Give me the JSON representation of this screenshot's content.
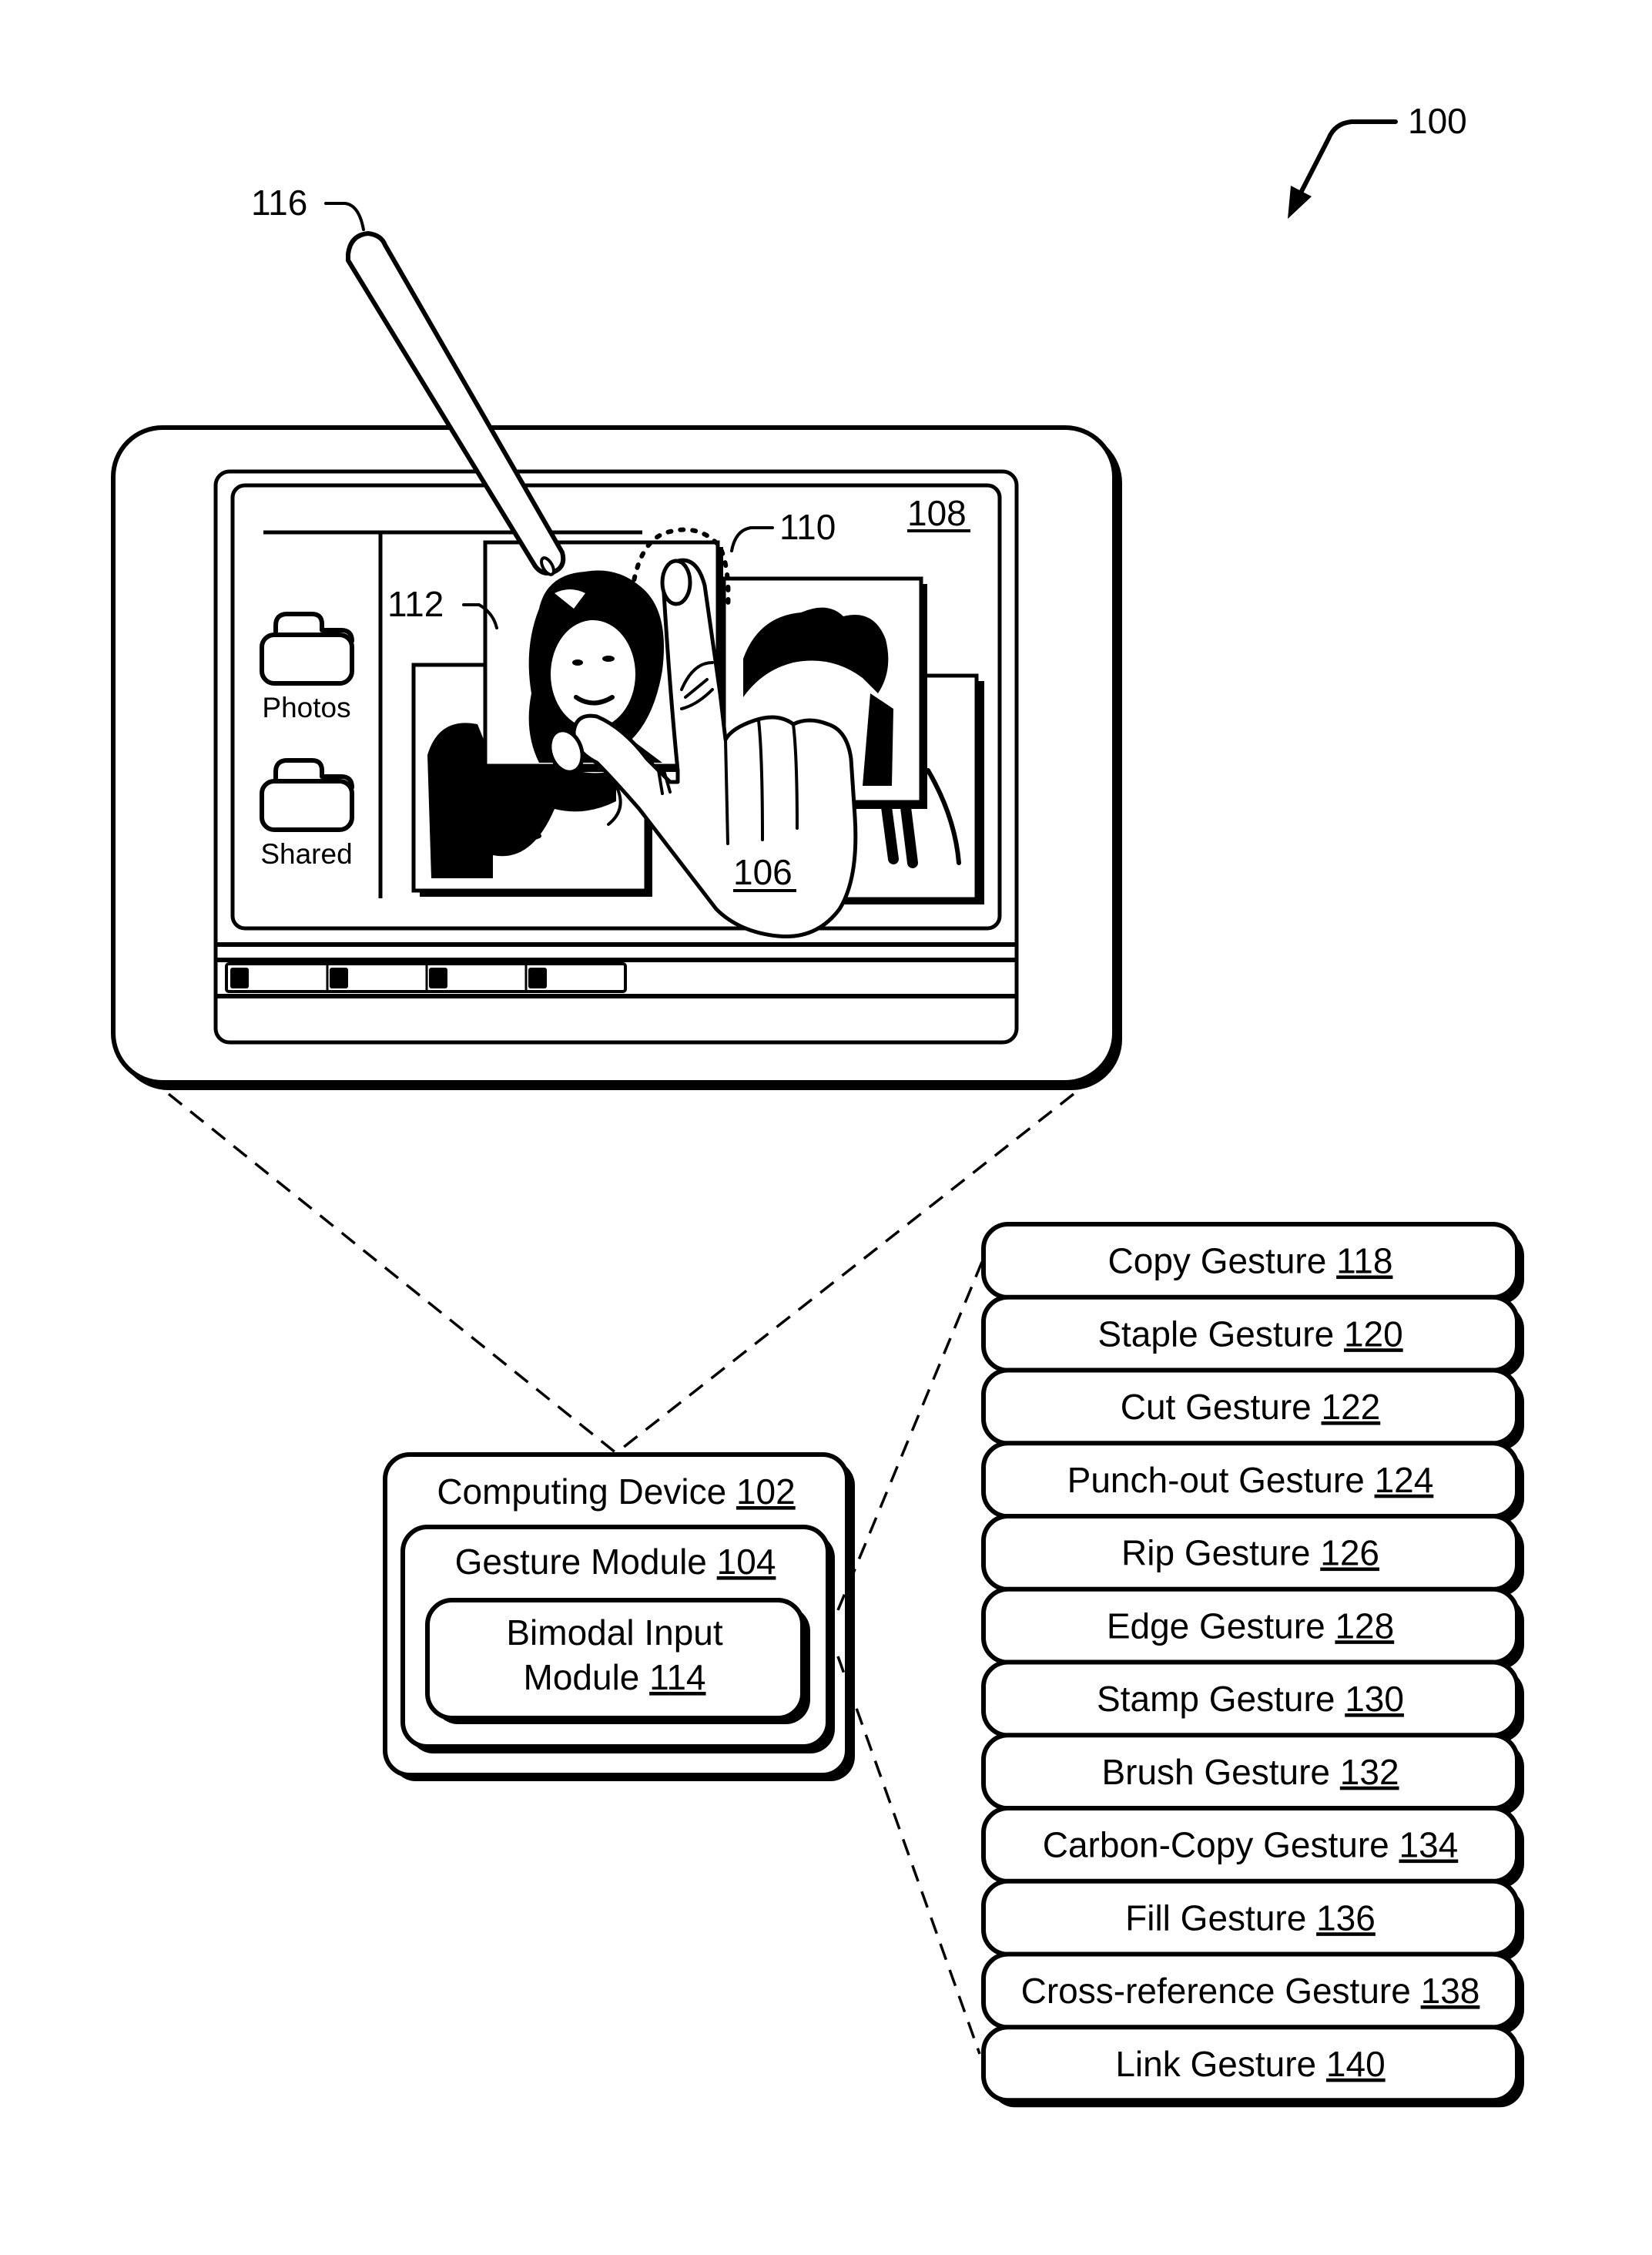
{
  "figure": {
    "ref_label": "100",
    "colors": {
      "ink": "#000000",
      "paper": "#ffffff"
    }
  },
  "stylus": {
    "ref_label": "116"
  },
  "device": {
    "display_ref": "108",
    "touch_ref": "110",
    "image_ref": "112",
    "hand_ref": "106",
    "sidebar": [
      {
        "icon": "folder-icon",
        "label": "Photos"
      },
      {
        "icon": "folder-icon",
        "label": "Shared"
      }
    ],
    "taskbar_item_count": 4
  },
  "modules": {
    "computing_device": {
      "label": "Computing Device",
      "ref": "102"
    },
    "gesture_module": {
      "label": "Gesture Module",
      "ref": "104"
    },
    "bimodal_input_module": {
      "label_line1": "Bimodal Input",
      "label_line2": "Module",
      "ref": "114"
    }
  },
  "gestures": [
    {
      "label": "Copy Gesture",
      "ref": "118"
    },
    {
      "label": "Staple Gesture",
      "ref": "120"
    },
    {
      "label": "Cut Gesture",
      "ref": "122"
    },
    {
      "label": "Punch-out Gesture",
      "ref": "124"
    },
    {
      "label": "Rip Gesture",
      "ref": "126"
    },
    {
      "label": "Edge Gesture",
      "ref": "128"
    },
    {
      "label": "Stamp Gesture",
      "ref": "130"
    },
    {
      "label": "Brush Gesture",
      "ref": "132"
    },
    {
      "label": "Carbon-Copy Gesture",
      "ref": "134"
    },
    {
      "label": "Fill Gesture",
      "ref": "136"
    },
    {
      "label": "Cross-reference Gesture",
      "ref": "138"
    },
    {
      "label": "Link Gesture",
      "ref": "140"
    }
  ]
}
